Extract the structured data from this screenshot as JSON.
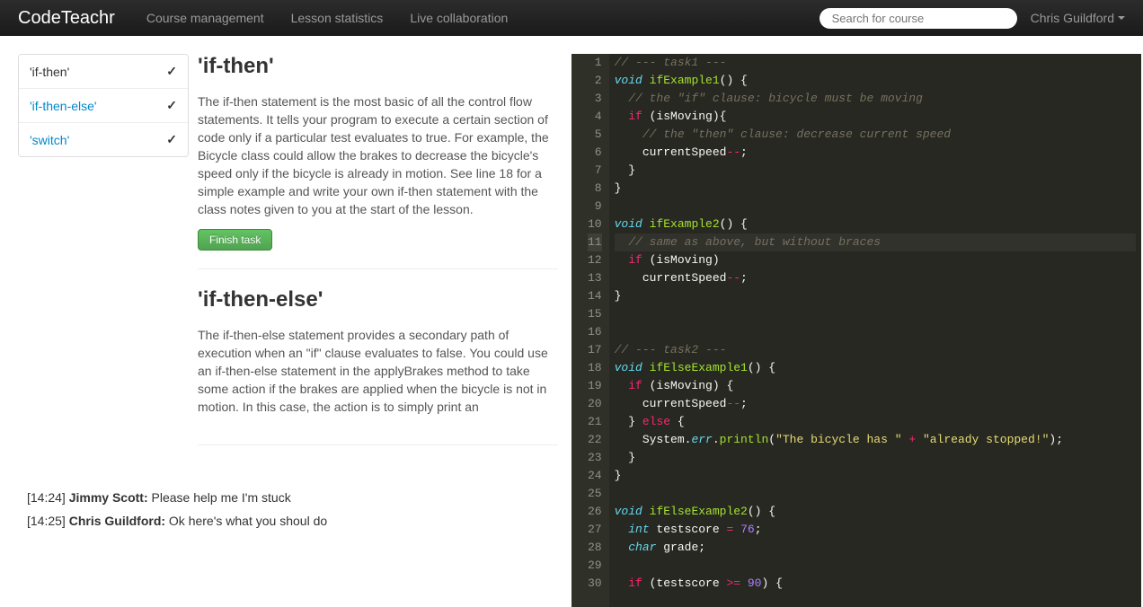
{
  "navbar": {
    "brand": "CodeTeachr",
    "links": [
      "Course management",
      "Lesson statistics",
      "Live collaboration"
    ],
    "search_placeholder": "Search for course",
    "user": "Chris Guildford"
  },
  "tasks": {
    "items": [
      {
        "label": "'if-then'",
        "done": true,
        "active": true
      },
      {
        "label": "'if-then-else'",
        "done": true,
        "active": false
      },
      {
        "label": "'switch'",
        "done": true,
        "active": false
      }
    ],
    "sections": [
      {
        "title": "'if-then'",
        "body": "The if-then statement is the most basic of all the control flow statements. It tells your program to execute a certain section of code only if a particular test evaluates to true. For example, the Bicycle class could allow the brakes to decrease the bicycle's speed only if the bicycle is already in motion. See line 18 for a simple example and write your own if-then statement with the class notes given to you at the start of the lesson.",
        "button": "Finish task"
      },
      {
        "title": "'if-then-else'",
        "body": "The if-then-else statement provides a secondary path of execution when an \"if\" clause evaluates to false. You could use an if-then-else statement in the applyBrakes method to take some action if the brakes are applied when the bicycle is not in motion. In this case, the action is to simply print an"
      }
    ]
  },
  "chat": [
    {
      "time": "[14:24]",
      "author": "Jimmy Scott:",
      "text": " Please help me I'm stuck"
    },
    {
      "time": "[14:25]",
      "author": "Chris Guildford:",
      "text": " Ok here's what you shoul do"
    }
  ],
  "editor": {
    "active_line": 11,
    "lines": [
      [
        {
          "t": "// --- task1 ---",
          "c": "c-comment"
        }
      ],
      [
        {
          "t": "void",
          "c": "c-type"
        },
        {
          "t": " "
        },
        {
          "t": "ifExample1",
          "c": "c-func"
        },
        {
          "t": "() {"
        }
      ],
      [
        {
          "t": "  "
        },
        {
          "t": "// the \"if\" clause: bicycle must be moving",
          "c": "c-comment"
        }
      ],
      [
        {
          "t": "  "
        },
        {
          "t": "if",
          "c": "c-keyword"
        },
        {
          "t": " (isMoving){"
        }
      ],
      [
        {
          "t": "    "
        },
        {
          "t": "// the \"then\" clause: decrease current speed",
          "c": "c-comment"
        }
      ],
      [
        {
          "t": "    currentSpeed"
        },
        {
          "t": "--",
          "c": "c-keyword"
        },
        {
          "t": ";"
        }
      ],
      [
        {
          "t": "  }"
        }
      ],
      [
        {
          "t": "}"
        }
      ],
      [
        {
          "t": ""
        }
      ],
      [
        {
          "t": "void",
          "c": "c-type"
        },
        {
          "t": " "
        },
        {
          "t": "ifExample2",
          "c": "c-func"
        },
        {
          "t": "() {"
        }
      ],
      [
        {
          "t": "  "
        },
        {
          "t": "// same as above, but without braces",
          "c": "c-comment"
        }
      ],
      [
        {
          "t": "  "
        },
        {
          "t": "if",
          "c": "c-keyword"
        },
        {
          "t": " (isMoving)"
        }
      ],
      [
        {
          "t": "    currentSpeed"
        },
        {
          "t": "--",
          "c": "c-keyword"
        },
        {
          "t": ";"
        }
      ],
      [
        {
          "t": "}"
        }
      ],
      [
        {
          "t": ""
        }
      ],
      [
        {
          "t": ""
        }
      ],
      [
        {
          "t": "// --- task2 ---",
          "c": "c-comment"
        }
      ],
      [
        {
          "t": "void",
          "c": "c-type"
        },
        {
          "t": " "
        },
        {
          "t": "ifElseExample1",
          "c": "c-func"
        },
        {
          "t": "() {"
        }
      ],
      [
        {
          "t": "  "
        },
        {
          "t": "if",
          "c": "c-keyword"
        },
        {
          "t": " (isMoving) {"
        }
      ],
      [
        {
          "t": "    currentSpeed"
        },
        {
          "t": "--",
          "c": "c-keyword"
        },
        {
          "t": ";"
        }
      ],
      [
        {
          "t": "  } "
        },
        {
          "t": "else",
          "c": "c-keyword"
        },
        {
          "t": " {"
        }
      ],
      [
        {
          "t": "    System."
        },
        {
          "t": "err",
          "c": "c-type"
        },
        {
          "t": "."
        },
        {
          "t": "println",
          "c": "c-prop"
        },
        {
          "t": "("
        },
        {
          "t": "\"The bicycle has \"",
          "c": "c-string"
        },
        {
          "t": " "
        },
        {
          "t": "+",
          "c": "c-keyword"
        },
        {
          "t": " "
        },
        {
          "t": "\"already stopped!\"",
          "c": "c-string"
        },
        {
          "t": ");"
        }
      ],
      [
        {
          "t": "  }"
        }
      ],
      [
        {
          "t": "}"
        }
      ],
      [
        {
          "t": ""
        }
      ],
      [
        {
          "t": "void",
          "c": "c-type"
        },
        {
          "t": " "
        },
        {
          "t": "ifElseExample2",
          "c": "c-func"
        },
        {
          "t": "() {"
        }
      ],
      [
        {
          "t": "  "
        },
        {
          "t": "int",
          "c": "c-type"
        },
        {
          "t": " testscore "
        },
        {
          "t": "=",
          "c": "c-keyword"
        },
        {
          "t": " "
        },
        {
          "t": "76",
          "c": "c-num"
        },
        {
          "t": ";"
        }
      ],
      [
        {
          "t": "  "
        },
        {
          "t": "char",
          "c": "c-type"
        },
        {
          "t": " grade;"
        }
      ],
      [
        {
          "t": ""
        }
      ],
      [
        {
          "t": "  "
        },
        {
          "t": "if",
          "c": "c-keyword"
        },
        {
          "t": " (testscore "
        },
        {
          "t": ">=",
          "c": "c-keyword"
        },
        {
          "t": " "
        },
        {
          "t": "90",
          "c": "c-num"
        },
        {
          "t": ") {"
        }
      ]
    ]
  }
}
